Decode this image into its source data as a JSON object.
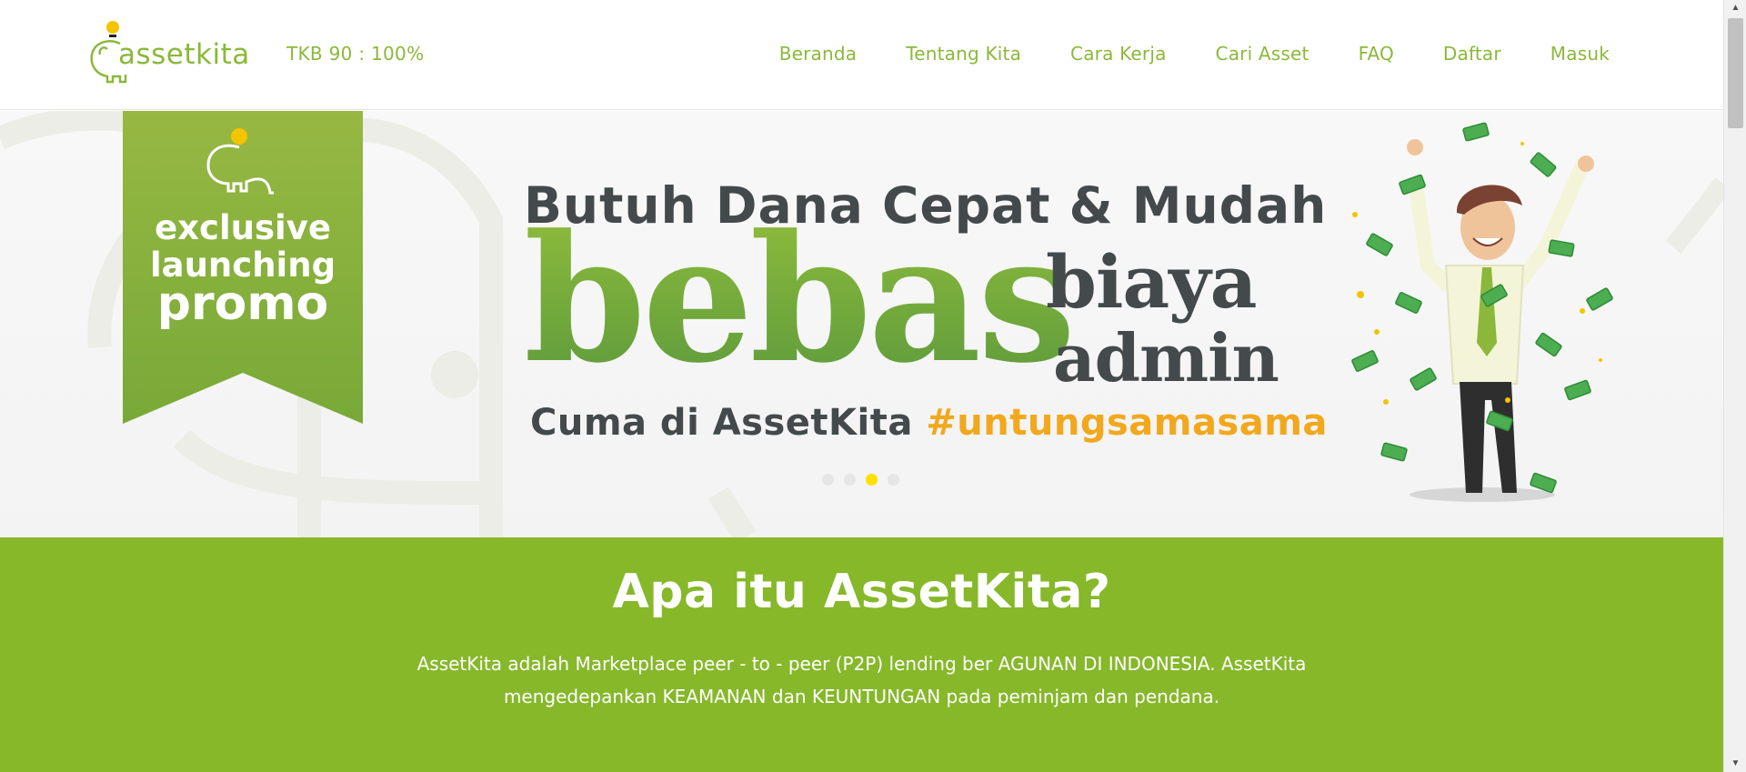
{
  "header": {
    "logo_text": "assetkita",
    "tkb": "TKB 90 : 100%",
    "nav": [
      "Beranda",
      "Tentang Kita",
      "Cara Kerja",
      "Cari Asset",
      "FAQ",
      "Daftar",
      "Masuk"
    ]
  },
  "hero": {
    "ribbon": {
      "line1": "exclusive",
      "line2": "launching",
      "line3": "promo"
    },
    "headline": "Butuh Dana Cepat & Mudah",
    "big_word": "bebas",
    "side_word_1": "biaya",
    "side_word_2": "admin",
    "tagline_main": "Cuma di AssetKita ",
    "tagline_hash": "#untungsamasama",
    "slides_count": 4,
    "active_slide": 3
  },
  "about": {
    "title": "Apa itu AssetKita?",
    "description_line1": "AssetKita adalah Marketplace peer - to - peer (P2P) lending ber AGUNAN DI INDONESIA. AssetKita",
    "description_line2": "mengedepankan KEAMANAN dan KEUNTUNGAN pada peminjam dan pendana."
  },
  "colors": {
    "brand_green": "#86b82a",
    "text_green": "#8bb83a",
    "dark_text": "#444a4c",
    "accent_orange": "#f2a81d",
    "active_dot": "#ffe000"
  }
}
